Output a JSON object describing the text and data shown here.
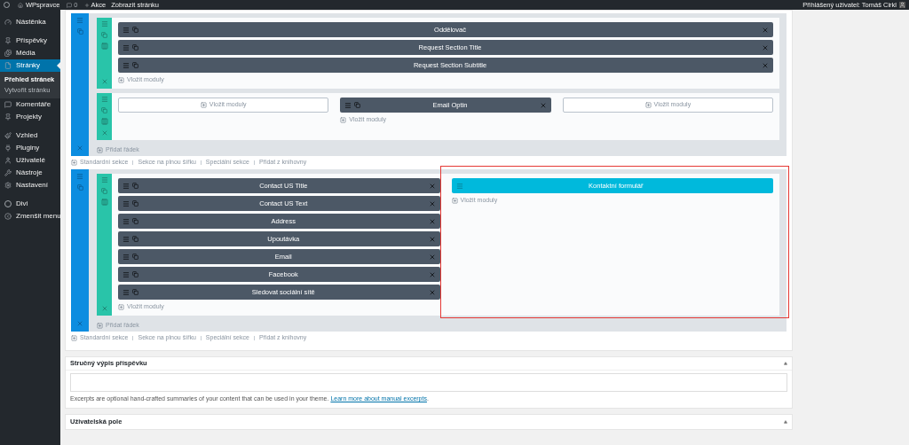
{
  "admin_bar": {
    "site": "WPspravce",
    "comments": "0",
    "new": "Akce",
    "view": "Zobrazit stránku",
    "user": "Přihlášený uživatel: Tomáš Cirkl"
  },
  "sidebar": {
    "groups": [
      [
        {
          "label": "Nástěnka",
          "selected": false
        }
      ],
      [
        {
          "label": "Příspěvky",
          "selected": false
        },
        {
          "label": "Média",
          "selected": false
        },
        {
          "label": "Stránky",
          "selected": true,
          "submenu": [
            {
              "label": "Přehled stránek",
              "selected": true
            },
            {
              "label": "Vytvořit stránku",
              "selected": false
            }
          ]
        },
        {
          "label": "Komentáře",
          "selected": false
        },
        {
          "label": "Projekty",
          "selected": false
        }
      ],
      [
        {
          "label": "Vzhled",
          "selected": false
        },
        {
          "label": "Pluginy",
          "selected": false
        },
        {
          "label": "Uživatelé",
          "selected": false
        },
        {
          "label": "Nástroje",
          "selected": false
        },
        {
          "label": "Nastavení",
          "selected": false
        }
      ],
      [
        {
          "label": "Divi",
          "selected": false
        },
        {
          "label": "Zmenšit menu",
          "selected": false
        }
      ]
    ]
  },
  "builder": {
    "sections": [
      {
        "rows": [
          {
            "columns": [
              {
                "kind": "modules",
                "modules": [
                  {
                    "title": "Oddělovač",
                    "kind": "standard"
                  },
                  {
                    "title": "Request Section Title",
                    "kind": "standard"
                  },
                  {
                    "title": "Request Section Subtitle",
                    "kind": "standard"
                  }
                ],
                "insert_label": "Vložit moduly"
              }
            ]
          },
          {
            "columns": [
              {
                "kind": "empty",
                "insert_label": "Vložit moduly"
              },
              {
                "kind": "modules",
                "modules": [
                  {
                    "title": "Email Optin",
                    "kind": "standard"
                  }
                ],
                "insert_label": "Vložit moduly"
              },
              {
                "kind": "empty",
                "insert_label": "Vložit moduly"
              }
            ]
          }
        ],
        "add_row": "Přidat řádek",
        "links": [
          "Standardní sekce",
          "Sekce na plnou šířku",
          "Speciální sekce",
          "Přidat z knihovny"
        ]
      },
      {
        "rows": [
          {
            "columns": [
              {
                "kind": "modules",
                "modules": [
                  {
                    "title": "Contact US Title",
                    "kind": "standard"
                  },
                  {
                    "title": "Contact US Text",
                    "kind": "standard"
                  },
                  {
                    "title": "Address",
                    "kind": "standard"
                  },
                  {
                    "title": "Upoutávka",
                    "kind": "standard"
                  },
                  {
                    "title": "Email",
                    "kind": "standard"
                  },
                  {
                    "title": "Facebook",
                    "kind": "standard"
                  },
                  {
                    "title": "Sledovat sociální sítě",
                    "kind": "standard"
                  }
                ],
                "insert_label": "Vložit moduly"
              },
              {
                "kind": "modules",
                "highlighted": true,
                "modules": [
                  {
                    "title": "Kontaktní formulář",
                    "kind": "accent"
                  }
                ],
                "insert_label": "Vložit moduly"
              }
            ]
          }
        ],
        "add_row": "Přidat řádek",
        "links": [
          "Standardní sekce",
          "Sekce na plnou šířku",
          "Speciální sekce",
          "Přidat z knihovny"
        ]
      }
    ]
  },
  "excerpt_box": {
    "title": "Stručný výpis příspěvku",
    "help": "Excerpts are optional hand-crafted summaries of your content that can be used in your theme.",
    "link": "Learn more about manual excerpts",
    "after_link": "."
  },
  "custom_fields_box": {
    "title": "Uživatelská pole"
  }
}
